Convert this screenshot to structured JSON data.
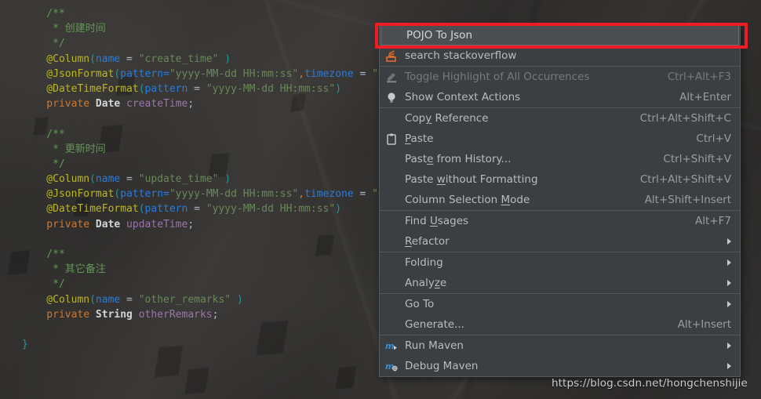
{
  "editor": {
    "code_lines": [
      {
        "indent": 4,
        "spans": [
          {
            "cls": "cm",
            "t": "/**"
          }
        ]
      },
      {
        "indent": 4,
        "spans": [
          {
            "cls": "cm",
            "t": " * 创建时间"
          }
        ]
      },
      {
        "indent": 4,
        "spans": [
          {
            "cls": "cm",
            "t": " */"
          }
        ]
      },
      {
        "indent": 4,
        "spans": [
          {
            "cls": "ann",
            "t": "@Column"
          },
          {
            "cls": "brc",
            "t": "("
          },
          {
            "cls": "par",
            "t": "name"
          },
          {
            "cls": "pl",
            "t": " = "
          },
          {
            "cls": "str",
            "t": "\"create_time\""
          },
          {
            "cls": "brc",
            "t": " )"
          }
        ]
      },
      {
        "indent": 4,
        "spans": [
          {
            "cls": "ann",
            "t": "@JsonFormat"
          },
          {
            "cls": "brc",
            "t": "("
          },
          {
            "cls": "par",
            "t": "pattern="
          },
          {
            "cls": "str",
            "t": "\"yyyy-MM-dd HH:mm:ss\""
          },
          {
            "cls": "kw",
            "t": ","
          },
          {
            "cls": "par",
            "t": "timezone"
          },
          {
            "cls": "pl",
            "t": " = "
          },
          {
            "cls": "str",
            "t": "\"GMT"
          }
        ]
      },
      {
        "indent": 4,
        "spans": [
          {
            "cls": "ann",
            "t": "@DateTimeFormat"
          },
          {
            "cls": "brc",
            "t": "("
          },
          {
            "cls": "par",
            "t": "pattern"
          },
          {
            "cls": "pl",
            "t": " = "
          },
          {
            "cls": "str",
            "t": "\"yyyy-MM-dd HH:mm:ss\""
          },
          {
            "cls": "brc",
            "t": ")"
          }
        ]
      },
      {
        "indent": 4,
        "spans": [
          {
            "cls": "kw",
            "t": "private "
          },
          {
            "cls": "ty",
            "t": "Date"
          },
          {
            "cls": "fld",
            "t": " createTime"
          },
          {
            "cls": "pl",
            "t": ";"
          }
        ]
      },
      {
        "indent": 0,
        "spans": []
      },
      {
        "indent": 4,
        "spans": [
          {
            "cls": "cm",
            "t": "/**"
          }
        ]
      },
      {
        "indent": 4,
        "spans": [
          {
            "cls": "cm",
            "t": " * 更新时间"
          }
        ]
      },
      {
        "indent": 4,
        "spans": [
          {
            "cls": "cm",
            "t": " */"
          }
        ]
      },
      {
        "indent": 4,
        "spans": [
          {
            "cls": "ann",
            "t": "@Column"
          },
          {
            "cls": "brc",
            "t": "("
          },
          {
            "cls": "par",
            "t": "name"
          },
          {
            "cls": "pl",
            "t": " = "
          },
          {
            "cls": "str",
            "t": "\"update_time\""
          },
          {
            "cls": "brc",
            "t": " )"
          }
        ]
      },
      {
        "indent": 4,
        "spans": [
          {
            "cls": "ann",
            "t": "@JsonFormat"
          },
          {
            "cls": "brc",
            "t": "("
          },
          {
            "cls": "par",
            "t": "pattern="
          },
          {
            "cls": "str",
            "t": "\"yyyy-MM-dd HH:mm:ss\""
          },
          {
            "cls": "kw",
            "t": ","
          },
          {
            "cls": "par",
            "t": "timezone"
          },
          {
            "cls": "pl",
            "t": " = "
          },
          {
            "cls": "str",
            "t": "\"GMT"
          }
        ]
      },
      {
        "indent": 4,
        "spans": [
          {
            "cls": "ann",
            "t": "@DateTimeFormat"
          },
          {
            "cls": "brc",
            "t": "("
          },
          {
            "cls": "par",
            "t": "pattern"
          },
          {
            "cls": "pl",
            "t": " = "
          },
          {
            "cls": "str",
            "t": "\"yyyy-MM-dd HH:mm:ss\""
          },
          {
            "cls": "brc",
            "t": ")"
          }
        ]
      },
      {
        "indent": 4,
        "spans": [
          {
            "cls": "kw",
            "t": "private "
          },
          {
            "cls": "ty",
            "t": "Date"
          },
          {
            "cls": "fld",
            "t": " updateTime"
          },
          {
            "cls": "pl",
            "t": ";"
          }
        ]
      },
      {
        "indent": 0,
        "spans": []
      },
      {
        "indent": 4,
        "spans": [
          {
            "cls": "cm",
            "t": "/**"
          }
        ]
      },
      {
        "indent": 4,
        "spans": [
          {
            "cls": "cm",
            "t": " * 其它备注"
          }
        ]
      },
      {
        "indent": 4,
        "spans": [
          {
            "cls": "cm",
            "t": " */"
          }
        ]
      },
      {
        "indent": 4,
        "spans": [
          {
            "cls": "ann",
            "t": "@Column"
          },
          {
            "cls": "brc",
            "t": "("
          },
          {
            "cls": "par",
            "t": "name"
          },
          {
            "cls": "pl",
            "t": " = "
          },
          {
            "cls": "str",
            "t": "\"other_remarks\""
          },
          {
            "cls": "brc",
            "t": " )"
          }
        ]
      },
      {
        "indent": 4,
        "spans": [
          {
            "cls": "kw",
            "t": "private "
          },
          {
            "cls": "ty",
            "t": "String"
          },
          {
            "cls": "fld",
            "t": " otherRemarks"
          },
          {
            "cls": "pl",
            "t": ";"
          }
        ]
      },
      {
        "indent": 0,
        "spans": []
      },
      {
        "indent": 0,
        "spans": [
          {
            "cls": "brc",
            "t": "}"
          }
        ]
      }
    ]
  },
  "context_menu": {
    "groups": [
      {
        "items": [
          {
            "label": "POJO To Json",
            "accel": "",
            "icon": "",
            "selected": true,
            "disabled": false,
            "submenu": false
          },
          {
            "label": "search stackoverflow",
            "accel": "",
            "icon": "stackoverflow-icon",
            "selected": false,
            "disabled": false,
            "submenu": false
          }
        ]
      },
      {
        "items": [
          {
            "label": "Toggle Highlight of All Occurrences",
            "accel": "Ctrl+Alt+F3",
            "icon": "highlighter-icon",
            "selected": false,
            "disabled": true,
            "submenu": false
          },
          {
            "label": "Show Context Actions",
            "accel": "Alt+Enter",
            "icon": "lightbulb-icon",
            "selected": false,
            "disabled": false,
            "submenu": false
          }
        ]
      },
      {
        "items": [
          {
            "label": "Copy Reference",
            "accel": "Ctrl+Alt+Shift+C",
            "icon": "",
            "selected": false,
            "disabled": false,
            "submenu": false,
            "mnemonic": 3
          },
          {
            "label": "Paste",
            "accel": "Ctrl+V",
            "icon": "clipboard-icon",
            "selected": false,
            "disabled": false,
            "submenu": false,
            "mnemonic": 0
          },
          {
            "label": "Paste from History...",
            "accel": "Ctrl+Shift+V",
            "icon": "",
            "selected": false,
            "disabled": false,
            "submenu": false,
            "mnemonic": 4
          },
          {
            "label": "Paste without Formatting",
            "accel": "Ctrl+Alt+Shift+V",
            "icon": "",
            "selected": false,
            "disabled": false,
            "submenu": false,
            "mnemonic": 6
          },
          {
            "label": "Column Selection Mode",
            "accel": "Alt+Shift+Insert",
            "icon": "",
            "selected": false,
            "disabled": false,
            "submenu": false,
            "mnemonic": 17
          }
        ]
      },
      {
        "items": [
          {
            "label": "Find Usages",
            "accel": "Alt+F7",
            "icon": "",
            "selected": false,
            "disabled": false,
            "submenu": false,
            "mnemonic": 5
          },
          {
            "label": "Refactor",
            "accel": "",
            "icon": "",
            "selected": false,
            "disabled": false,
            "submenu": true,
            "mnemonic": 0
          }
        ]
      },
      {
        "items": [
          {
            "label": "Folding",
            "accel": "",
            "icon": "",
            "selected": false,
            "disabled": false,
            "submenu": true
          },
          {
            "label": "Analyze",
            "accel": "",
            "icon": "",
            "selected": false,
            "disabled": false,
            "submenu": true,
            "mnemonic": 5
          }
        ]
      },
      {
        "items": [
          {
            "label": "Go To",
            "accel": "",
            "icon": "",
            "selected": false,
            "disabled": false,
            "submenu": true
          },
          {
            "label": "Generate...",
            "accel": "Alt+Insert",
            "icon": "",
            "selected": false,
            "disabled": false,
            "submenu": false
          }
        ]
      },
      {
        "items": [
          {
            "label": "Run Maven",
            "accel": "",
            "icon": "maven-run-icon",
            "selected": false,
            "disabled": false,
            "submenu": true
          },
          {
            "label": "Debug Maven",
            "accel": "",
            "icon": "maven-debug-icon",
            "selected": false,
            "disabled": false,
            "submenu": true
          }
        ]
      }
    ]
  },
  "annotation": {
    "highlight_color": "#ee1c25",
    "highlights_item": "POJO To Json"
  },
  "watermark": {
    "text": "https://blog.csdn.net/hongchenshijie"
  }
}
